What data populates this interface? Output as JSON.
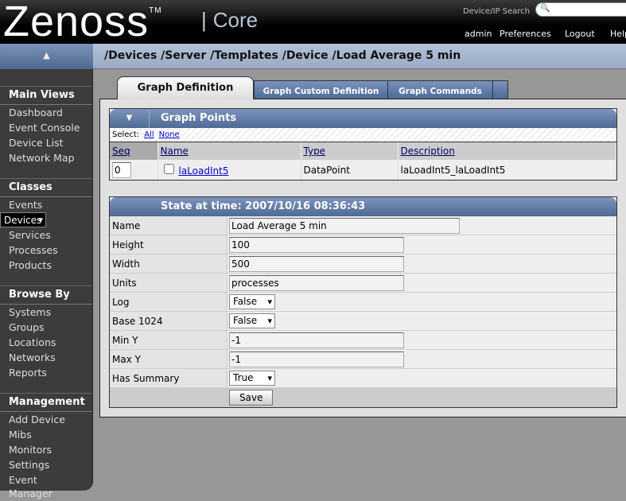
{
  "header": {
    "logo": "Zenoss",
    "tm": "TM",
    "product": "Core",
    "search_label": "Device/IP Search",
    "search_value": "",
    "links": [
      "admin",
      "Preferences",
      "Logout",
      "Help"
    ]
  },
  "breadcrumb": "/Devices /Server /Templates /Device /Load Average 5 min",
  "sidebar": {
    "sections": [
      {
        "title": "Main Views",
        "items": [
          "Dashboard",
          "Event Console",
          "Device List",
          "Network Map"
        ]
      },
      {
        "title": "Classes",
        "items": [
          "Events",
          "Devices",
          "Services",
          "Processes",
          "Products"
        ]
      },
      {
        "title": "Browse By",
        "items": [
          "Systems",
          "Groups",
          "Locations",
          "Networks",
          "Reports"
        ]
      },
      {
        "title": "Management",
        "items": [
          "Add Device",
          "Mibs",
          "Monitors",
          "Settings",
          "Event Manager"
        ]
      }
    ],
    "selected": "Devices"
  },
  "tabs": [
    "Graph Definition",
    "Graph Custom Definition",
    "Graph Commands"
  ],
  "graph_points": {
    "title": "Graph Points",
    "select_label": "Select:",
    "all": "All",
    "none": "None",
    "columns": [
      "Seq",
      "Name",
      "Type",
      "Description"
    ],
    "rows": [
      {
        "seq": "0",
        "name": "laLoadInt5",
        "type": "DataPoint",
        "description": "laLoadInt5_laLoadInt5"
      }
    ]
  },
  "state": {
    "title": "State at time: 2007/10/16 08:36:43",
    "fields": {
      "name": {
        "label": "Name",
        "value": "Load Average 5 min"
      },
      "height": {
        "label": "Height",
        "value": "100"
      },
      "width": {
        "label": "Width",
        "value": "500"
      },
      "units": {
        "label": "Units",
        "value": "processes"
      },
      "log": {
        "label": "Log",
        "value": "False"
      },
      "base1024": {
        "label": "Base 1024",
        "value": "False"
      },
      "miny": {
        "label": "Min Y",
        "value": "-1"
      },
      "maxy": {
        "label": "Max Y",
        "value": "-1"
      },
      "summary": {
        "label": "Has Summary",
        "value": "True"
      }
    },
    "save": "Save"
  }
}
